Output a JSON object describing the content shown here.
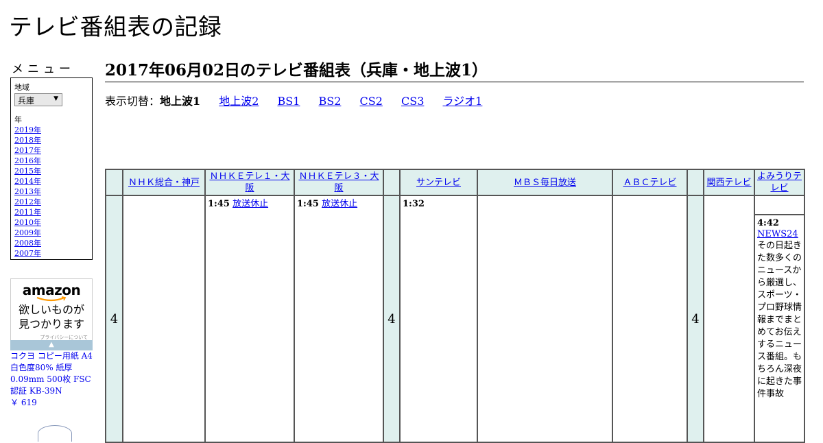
{
  "site": {
    "title": "テレビ番組表の記録"
  },
  "sidebar": {
    "menu_title": "メニュー",
    "region_label": "地域",
    "region_value": "兵庫",
    "year_label": "年",
    "years": [
      "2019年",
      "2018年",
      "2017年",
      "2016年",
      "2015年",
      "2014年",
      "2013年",
      "2012年",
      "2011年",
      "2010年",
      "2009年",
      "2008年",
      "2007年"
    ]
  },
  "ad": {
    "logo": "amazon",
    "copy_line1": "欲しいものが",
    "copy_line2": "見つかります",
    "privacy": "プライバシーについて",
    "product_name": "コクヨ コピー用紙 A4 白色度80% 紙厚 0.09mm 500枚 FSC認証 KB-39N",
    "product_price": "￥ 619"
  },
  "main": {
    "page_title": "2017年06月02日のテレビ番組表（兵庫・地上波1）",
    "switch_label": "表示切替：",
    "switch_current": "地上波1",
    "switch_links": [
      "地上波2",
      "BS1",
      "BS2",
      "CS2",
      "CS3",
      "ラジオ1"
    ]
  },
  "schedule": {
    "channels": [
      "ＮＨＫ総合・神戸",
      "ＮＨＫＥテレ１・大阪",
      "ＮＨＫＥテレ３・大阪",
      "サンテレビ",
      "ＭＢＳ毎日放送",
      "ＡＢＣテレビ",
      "関西テレビ",
      "よみうりテレビ"
    ],
    "hour": "4",
    "cells": {
      "etele1": {
        "time": "1:45",
        "title": "放送休止"
      },
      "etele3": {
        "time": "1:45",
        "title": "放送休止"
      },
      "sun": {
        "time": "1:32"
      },
      "ytv": {
        "time": "4:42",
        "title": "NEWS24",
        "desc": "その日起きた数多くのニュースから厳選し、スポーツ・プロ野球情報までまとめてお伝えするニュース番組。もちろん深夜に起きた事件事故"
      }
    }
  },
  "colors": {
    "header_bg": "#dff0ee",
    "link": "#0000ee",
    "ad_bar": "#a9c6d8"
  }
}
